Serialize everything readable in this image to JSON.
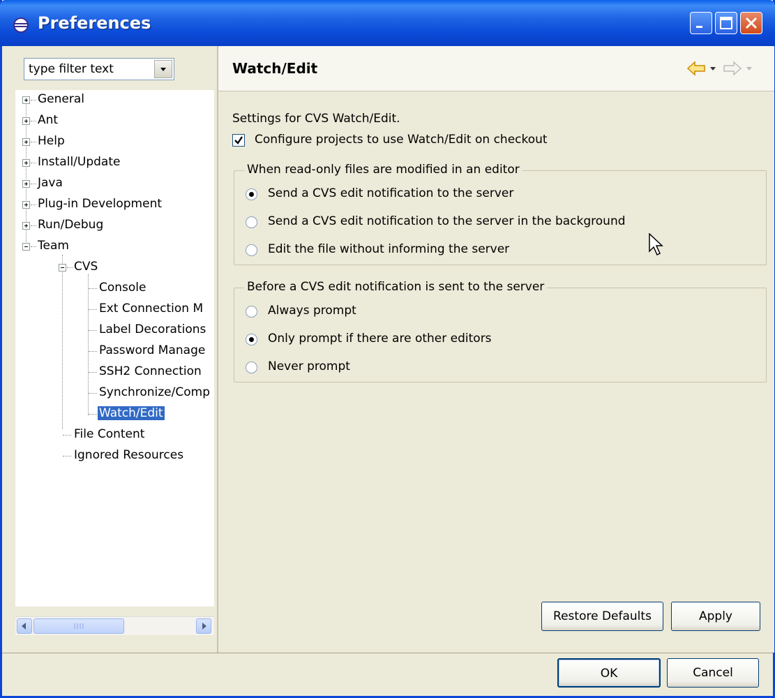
{
  "window": {
    "title": "Preferences"
  },
  "filter": {
    "placeholder": "type filter text"
  },
  "tree": {
    "top_level": [
      "General",
      "Ant",
      "Help",
      "Install/Update",
      "Java",
      "Plug-in Development",
      "Run/Debug",
      "Team"
    ],
    "team_children": [
      "CVS",
      "File Content",
      "Ignored Resources"
    ],
    "cvs_children": [
      "Console",
      "Ext Connection M",
      "Label Decorations",
      "Password Manage",
      "SSH2 Connection",
      "Synchronize/Comp",
      "Watch/Edit"
    ],
    "selected": "Watch/Edit"
  },
  "page": {
    "title": "Watch/Edit",
    "description": "Settings for CVS Watch/Edit.",
    "checkbox_label": "Configure projects to use Watch/Edit on checkout",
    "checkbox_checked": true
  },
  "group1": {
    "legend": "When read-only files are modified in an editor",
    "options": [
      "Send a CVS edit notification to the server",
      "Send a CVS edit notification to the server in the background",
      "Edit the file without informing the server"
    ],
    "selected_index": 0
  },
  "group2": {
    "legend": "Before a CVS edit notification is sent to the server",
    "options": [
      "Always prompt",
      "Only prompt if there are other editors",
      "Never prompt"
    ],
    "selected_index": 1
  },
  "buttons": {
    "restore_defaults": "Restore Defaults",
    "apply": "Apply",
    "ok": "OK",
    "cancel": "Cancel"
  },
  "colors": {
    "titlebar": "#0b4bd8",
    "selection": "#316ac5",
    "nav_back": "#e8a800"
  }
}
